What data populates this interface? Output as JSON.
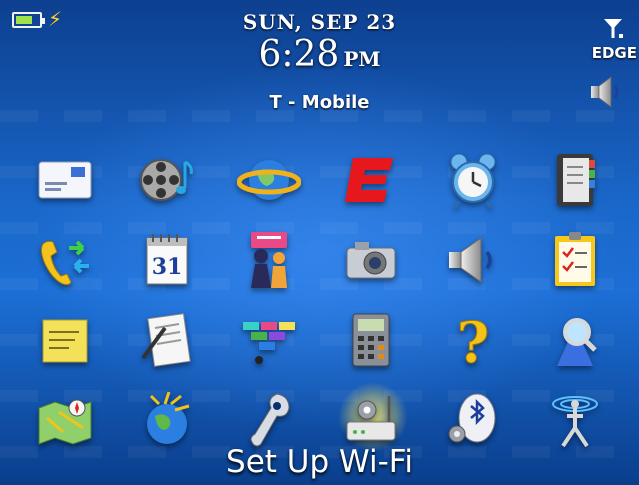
{
  "status_bar": {
    "date": "SUN, SEP 23",
    "time": "6:28",
    "ampm": "PM",
    "carrier": "T - Mobile",
    "network": "EDGE",
    "battery_level": 0.6,
    "charging_icon": "lightning-bolt-icon",
    "signal_icon": "signal-antenna-icon",
    "sound_profile_icon": "speaker-icon"
  },
  "icons": {
    "row1": [
      "messages-icon",
      "media-icon",
      "browser-icon",
      "espn-icon",
      "clock-icon",
      "address-book-icon"
    ],
    "row2": [
      "call-log-icon",
      "calendar-icon",
      "messenger-icon",
      "camera-icon",
      "sound-profiles-icon",
      "tasks-icon"
    ],
    "row3": [
      "memo-pad-icon",
      "documents-icon",
      "brick-breaker-icon",
      "calculator-icon",
      "help-icon",
      "search-icon"
    ],
    "row4": [
      "maps-icon",
      "world-icon",
      "options-icon",
      "wifi-setup-icon",
      "bluetooth-icon",
      "manage-connections-icon"
    ]
  },
  "calendar_day": "31",
  "selected_label": "Set Up Wi-Fi",
  "colors": {
    "background_top": "#0d3f8f",
    "background_mid": "#1c6fd6",
    "highlight": "#ffe850"
  }
}
